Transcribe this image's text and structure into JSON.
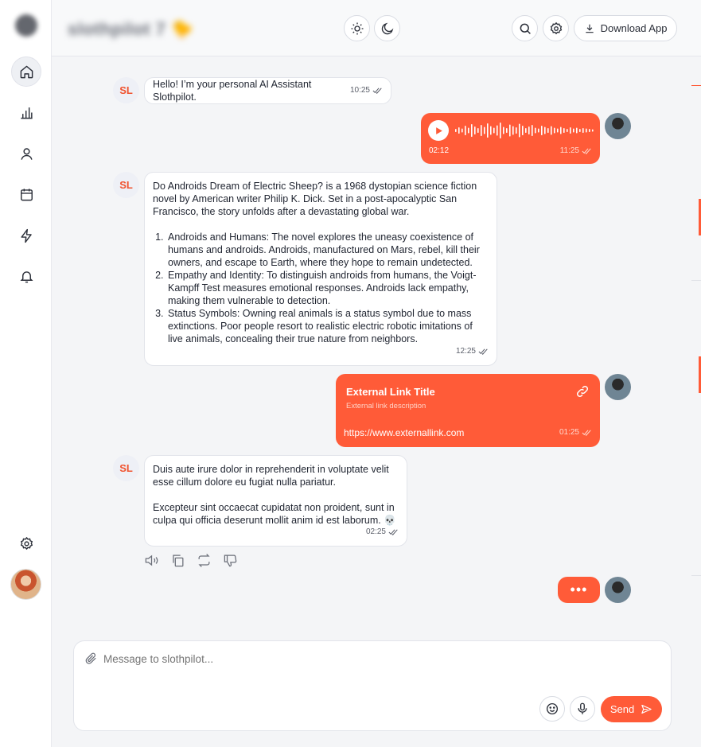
{
  "app": {
    "title": "slothpilot 7 🐤"
  },
  "sidebar": {
    "items": [
      {
        "name": "home",
        "icon": "home-icon"
      },
      {
        "name": "analytics",
        "icon": "bar-chart-icon"
      },
      {
        "name": "profile",
        "icon": "user-icon"
      },
      {
        "name": "calendar",
        "icon": "calendar-icon"
      },
      {
        "name": "activity",
        "icon": "lightning-icon"
      },
      {
        "name": "notifications",
        "icon": "bell-icon"
      },
      {
        "name": "settings",
        "icon": "gear-icon"
      }
    ]
  },
  "header": {
    "download_label": "Download App"
  },
  "messages": {
    "m1": {
      "avatar": "SL",
      "text": "Hello! I’m your personal AI Assistant Slothpilot.",
      "time": "10:25"
    },
    "m2": {
      "duration": "02:12",
      "time": "11:25"
    },
    "m3": {
      "avatar": "SL",
      "intro": "Do Androids Dream of Electric Sheep? is a 1968 dystopian science fiction novel by American writer Philip K. Dick. Set in a post-apocalyptic San Francisco, the story unfolds after a devastating global war.",
      "items": [
        "Androids and Humans: The novel explores the uneasy coexistence of humans and androids. Androids, manufactured on Mars, rebel, kill their owners, and escape to Earth, where they hope to remain undetected.",
        "Empathy and Identity: To distinguish androids from humans, the Voigt-Kampff Test measures emotional responses. Androids lack empathy, making them vulnerable to detection.",
        "Status Symbols: Owning real animals is a status symbol due to mass extinctions. Poor people resort to realistic electric robotic imitations of live animals, concealing their true nature from neighbors."
      ],
      "time": "12:25"
    },
    "m4": {
      "title": "External Link Title",
      "description": "External link description",
      "url": "https://www.externallink.com",
      "time": "01:25"
    },
    "m5": {
      "avatar": "SL",
      "para1": "Duis aute irure dolor in reprehenderit in voluptate velit esse cillum dolore eu fugiat nulla pariatur.",
      "para2": "Excepteur sint occaecat cupidatat non proident, sunt in culpa qui officia deserunt mollit anim id est laborum. 💀",
      "time": "02:25"
    },
    "typing": "•••"
  },
  "composer": {
    "placeholder": "Message to slothpilot...",
    "send_label": "Send"
  },
  "colors": {
    "accent": "#ff5b38",
    "bubble_border": "#e2e4ea"
  }
}
